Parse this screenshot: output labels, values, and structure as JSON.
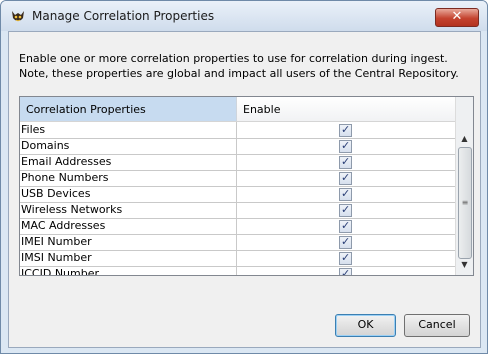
{
  "window": {
    "title": "Manage Correlation Properties",
    "close_label": "✕"
  },
  "description": "Enable one or more correlation properties to use for correlation during ingest. Note, these properties are global and impact all users of the Central Repository.",
  "table": {
    "columns": [
      "Correlation Properties",
      "Enable"
    ],
    "rows": [
      {
        "name": "Files",
        "enabled": true
      },
      {
        "name": "Domains",
        "enabled": true
      },
      {
        "name": "Email Addresses",
        "enabled": true
      },
      {
        "name": "Phone Numbers",
        "enabled": true
      },
      {
        "name": "USB Devices",
        "enabled": true
      },
      {
        "name": "Wireless Networks",
        "enabled": true
      },
      {
        "name": "MAC Addresses",
        "enabled": true
      },
      {
        "name": "IMEI Number",
        "enabled": true
      },
      {
        "name": "IMSI Number",
        "enabled": true
      },
      {
        "name": "ICCID Number",
        "enabled": true
      }
    ]
  },
  "buttons": {
    "ok": "OK",
    "cancel": "Cancel"
  },
  "checkmark": "✓"
}
